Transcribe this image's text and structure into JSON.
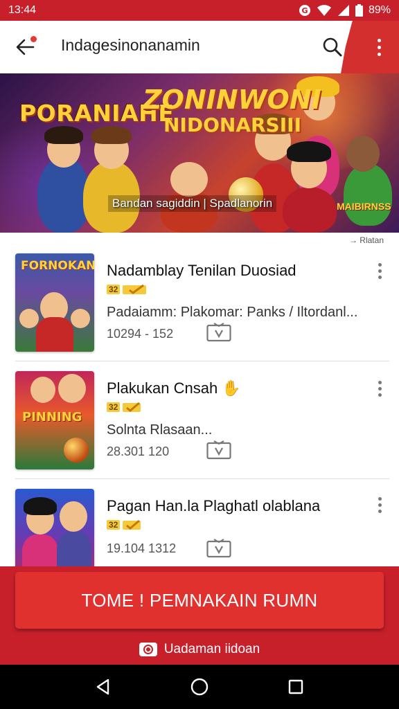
{
  "status_bar": {
    "time": "13:44",
    "battery": "89%"
  },
  "app_bar": {
    "title": "Indagesinonanamin"
  },
  "banner": {
    "title_left": "PORANIAHE",
    "title_right_line1": "ZONINWONI",
    "title_right_line2": "NIDONARSIII",
    "tagline": "Bandan sagiddin | Spadlanorin",
    "brand": "MAIBIRNSS",
    "caption": "→ Rlatan"
  },
  "items": [
    {
      "name": "Nadamblay Tenilan Duosiad",
      "rating_badge": "32",
      "description": "Padaiamm: Plakomar: Panks / Iltordanl...",
      "meta": "10294 - 152",
      "thumb_title": "FORNOKAN"
    },
    {
      "name": "Plakukan Cnsah",
      "rating_badge": "32",
      "description": "Solnta Rlasaan...",
      "meta": "28.301 120",
      "thumb_title": "PINNING"
    },
    {
      "name": "Pagan Han.la Plaghatl olablana",
      "rating_badge": "32",
      "description": "",
      "meta": "19.104 1312",
      "thumb_title": ""
    }
  ],
  "cta": {
    "label": "TOME ! PEMNAKAIN RUMN"
  },
  "footer": {
    "label": "Uadaman iidoan"
  },
  "colors": {
    "brand_red": "#c8202b",
    "cta_red": "#e0312f",
    "gold": "#ffd23a"
  },
  "icons": [
    "back-arrow-icon",
    "search-icon",
    "more-vert-icon",
    "tv-icon",
    "kebab-icon",
    "nav-back-icon",
    "nav-home-icon",
    "nav-recents-icon",
    "wifi-icon",
    "signal-icon",
    "battery-icon"
  ]
}
